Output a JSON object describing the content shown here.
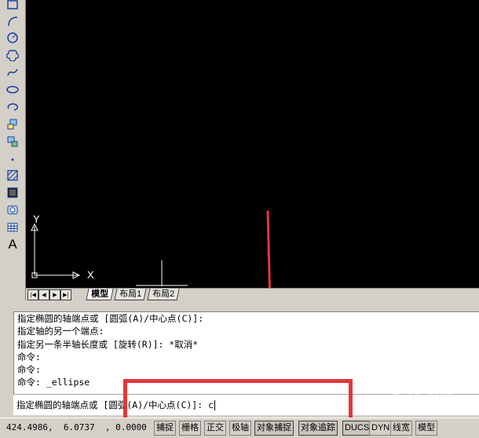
{
  "toolbar": {
    "tools": [
      {
        "icon": "rectangle-icon"
      },
      {
        "icon": "arc-icon"
      },
      {
        "icon": "circle-icon"
      },
      {
        "icon": "revision-cloud-icon"
      },
      {
        "icon": "spline-icon"
      },
      {
        "icon": "ellipse-icon"
      },
      {
        "icon": "ellipse-arc-icon"
      },
      {
        "icon": "insert-block-icon"
      },
      {
        "icon": "make-block-icon"
      },
      {
        "icon": "point-icon"
      },
      {
        "icon": "hatch-icon"
      },
      {
        "icon": "gradient-icon"
      },
      {
        "icon": "region-icon"
      },
      {
        "icon": "table-icon"
      },
      {
        "icon": "multiline-text-icon"
      }
    ],
    "text_tool_label": "A"
  },
  "canvas": {
    "ucs_y_label": "Y",
    "ucs_x_label": "X"
  },
  "layout_tabs": {
    "tabs": [
      "模型",
      "布局1",
      "布局2"
    ],
    "active": "模型",
    "nav_buttons": [
      "|◀",
      "◀",
      "▶",
      "▶|"
    ]
  },
  "command_history": [
    "指定椭圆的轴端点或 [圆弧(A)/中心点(C)]:",
    "指定轴的另一个端点:",
    "指定另一条半轴长度或 [旋转(R)]: *取消*",
    "命令:",
    "命令:",
    "命令: _ellipse"
  ],
  "command_input": {
    "prompt": "指定椭圆的轴端点或 [圆弧(A)/中心点(C)]: ",
    "value": "c"
  },
  "status_bar": {
    "coordinates": "424.4986,  6.0737  , 0.0000",
    "buttons": [
      "捕捉",
      "栅格",
      "正交",
      "极轴",
      "对象捕捉",
      "对象追踪",
      "DUCS",
      "DYN",
      "线宽",
      "模型"
    ]
  },
  "watermark": "Baidu经验",
  "colors": {
    "canvas_bg": "#000000",
    "highlight": "#e5363a",
    "ui_gray": "#d4d0c8"
  }
}
